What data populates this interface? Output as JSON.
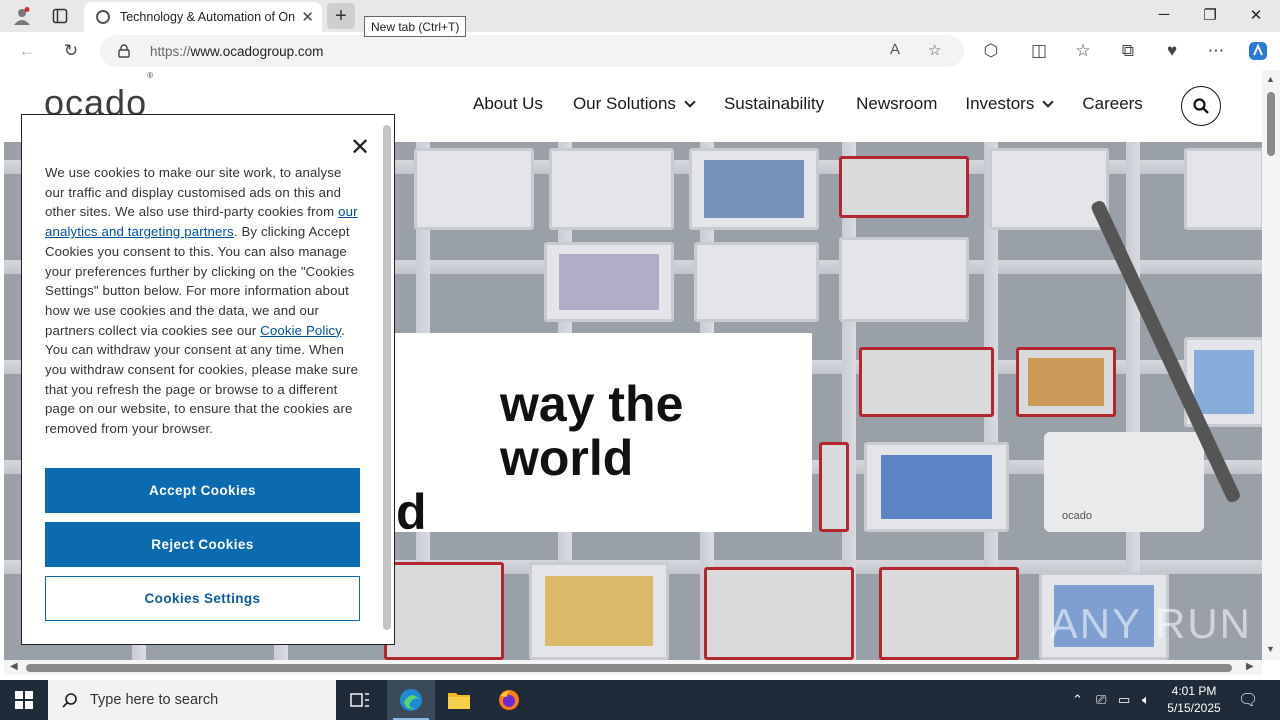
{
  "browser": {
    "tab_title": "Technology & Automation of Online Grocery | Ocado Group",
    "new_tab_tooltip": "New tab (Ctrl+T)",
    "url_prefix": "https://",
    "url_host": "www.ocadogroup.com"
  },
  "site": {
    "logo": "ocado",
    "nav": {
      "about": "About Us",
      "solutions": "Our Solutions",
      "sustainability": "Sustainability",
      "newsroom": "Newsroom",
      "investors": "Investors",
      "careers": "Careers"
    },
    "hero": {
      "line1": "way the world",
      "line2": "d",
      "robot_label": "ocado"
    },
    "watermark": "ANY RUN"
  },
  "cookie_banner": {
    "text_1": "We use cookies to make our site work, to analyse our traffic and display customised ads on this and other sites. We also use third-party cookies from ",
    "link_partners": "our analytics and targeting partners",
    "text_2": ". By clicking Accept Cookies you consent to this. You can also manage your preferences further by clicking on the \"Cookies Settings\" button below. For more information about how we use cookies and the data, we and our partners collect via cookies see our ",
    "link_policy": "Cookie Policy",
    "text_3": ". You can withdraw your consent at any time. When you withdraw consent for cookies, please make sure that you refresh the page or browse to a different page on our website, to ensure that the cookies are removed from your browser.",
    "accept": "Accept Cookies",
    "reject": "Reject Cookies",
    "settings": "Cookies Settings"
  },
  "taskbar": {
    "search_placeholder": "Type here to search",
    "time": "4:01 PM",
    "date": "5/15/2025"
  }
}
